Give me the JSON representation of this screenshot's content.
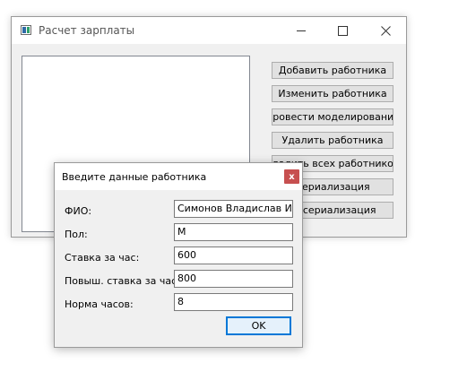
{
  "main_window": {
    "title": "Расчет зарплаты",
    "buttons": {
      "add": "Добавить работника",
      "edit": "Изменить работника",
      "simulate": "Провести моделирование",
      "delete": "Удалить работника",
      "delete_all": "Удалить всех работников",
      "serialize": "Сериализация",
      "deserialize": "Десериализация"
    }
  },
  "dialog": {
    "title": "Введите данные работника",
    "close_glyph": "x",
    "fields": {
      "fio_label": "ФИО:",
      "fio_value": "Симонов Владислав Игоревич",
      "gender_label": "Пол:",
      "gender_value": "М",
      "rate_label": "Ставка за час:",
      "rate_value": "600",
      "raised_rate_label": "Повыш. ставка за час:",
      "raised_rate_value": "800",
      "hours_label": "Норма часов:",
      "hours_value": "8"
    },
    "ok_label": "OK"
  },
  "colors": {
    "ok_border": "#0078d7",
    "close_red": "#c75050",
    "window_bg": "#f0f0f0"
  },
  "icons": [
    "app-icon",
    "minimize-icon",
    "maximize-icon",
    "close-icon"
  ]
}
